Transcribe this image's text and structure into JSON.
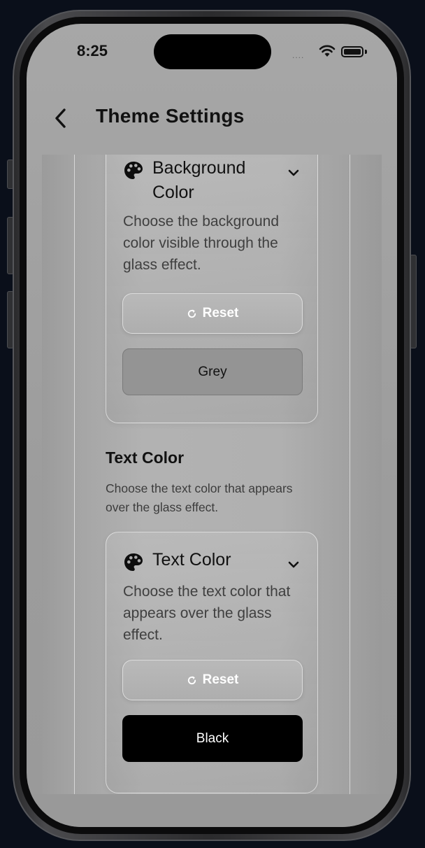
{
  "status_bar": {
    "time": "8:25",
    "signal": "....",
    "icons": [
      "wifi-icon",
      "battery-icon"
    ]
  },
  "header": {
    "back_icon": "chevron-left-icon",
    "title": "Theme Settings"
  },
  "background_card": {
    "icon": "palette-icon",
    "title": "Background Color",
    "chevron": "chevron-down-icon",
    "description": "Choose the background color visible through the glass effect.",
    "reset_label": "Reset",
    "selected_value": "Grey",
    "selected_color": "#949494"
  },
  "text_section": {
    "title": "Text Color",
    "description": "Choose the text color that appears over the glass effect."
  },
  "text_card": {
    "icon": "palette-icon",
    "title": "Text Color",
    "chevron": "chevron-down-icon",
    "description": "Choose the text color that appears over the glass effect.",
    "reset_label": "Reset",
    "selected_value": "Black",
    "selected_color": "#000000"
  }
}
